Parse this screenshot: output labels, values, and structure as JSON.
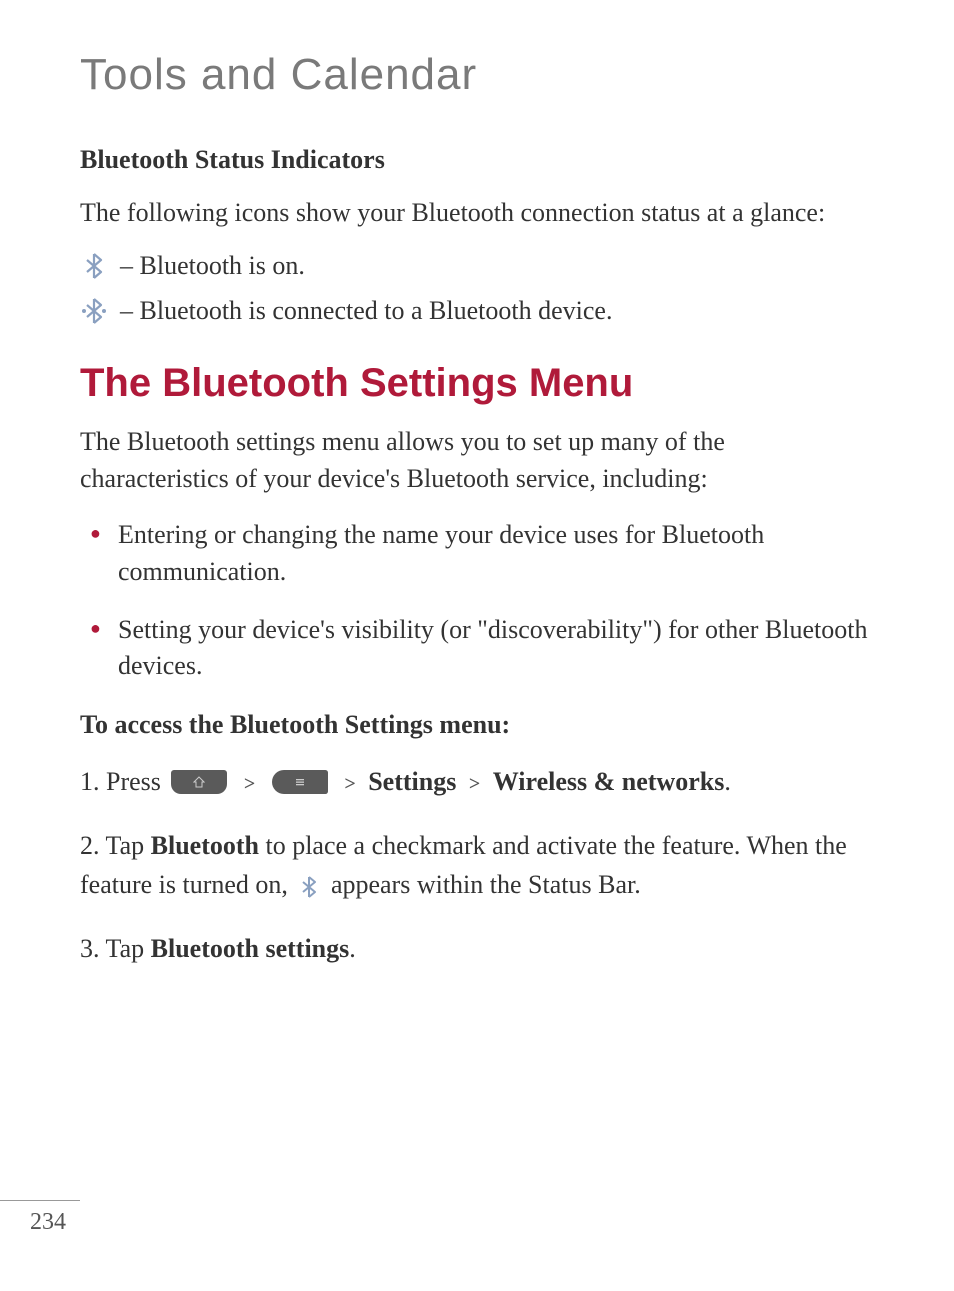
{
  "page_title": "Tools and Calendar",
  "section_subtitle": "Bluetooth Status Indicators",
  "intro_text": "The following icons show your Bluetooth connection status at a glance:",
  "indicators": [
    {
      "label": " – Bluetooth is on."
    },
    {
      "label": " – Bluetooth is connected to a Bluetooth device."
    }
  ],
  "section_heading": "The Bluetooth Settings Menu",
  "settings_intro": "The Bluetooth settings menu allows you to set up many of the characteristics of your device's Bluetooth service, including:",
  "bullets": [
    "Entering or changing the name your device uses for Bluetooth communication.",
    "Setting your device's visibility (or \"discoverability\") for other Bluetooth devices."
  ],
  "sub_heading": "To access the Bluetooth Settings menu:",
  "steps": {
    "step1": {
      "prefix": "1. Press ",
      "settings": "Settings",
      "wireless": "Wireless & networks"
    },
    "step2": {
      "prefix": "2. Tap ",
      "bold1": "Bluetooth",
      "mid": " to place a checkmark and activate the feature. When the feature is turned on, ",
      "suffix": " appears within the Status Bar."
    },
    "step3": {
      "prefix": "3. Tap ",
      "bold1": "Bluetooth settings",
      "suffix": "."
    }
  },
  "page_number": "234"
}
